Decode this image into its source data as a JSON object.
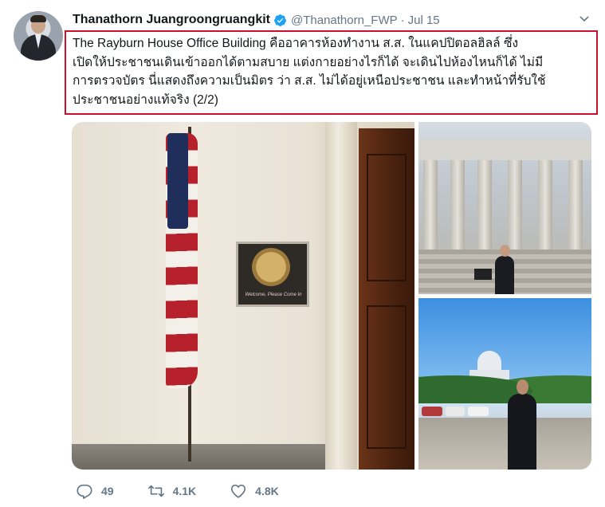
{
  "tweet": {
    "author_name": "Thanathorn Juangroongruangkit",
    "handle": "@Thanathorn_FWP",
    "separator": "·",
    "date": "Jul 15",
    "text_lines": [
      "The Rayburn House Office Building คืออาคารห้องทำงาน ส.ส. ในแคปปิตอลฮิลล์ ซึ่ง",
      "เปิดให้ประชาชนเดินเข้าออกได้ตามสบาย แต่งกายอย่างไรก็ได้ จะเดินไปห้องไหนก็ได้ ไม่มี",
      "การตรวจบัตร นี่แสดงถึงความเป็นมิตร ว่า ส.ส. ไม่ได้อยู่เหนือประชาชน และทำหน้าที่รับใช้",
      "ประชาชนอย่างแท้จริง (2/2)"
    ],
    "highlight_color": "#c8102e"
  },
  "media": {
    "plaque_text": "Welcome, Please Come In"
  },
  "actions": {
    "replies": "49",
    "retweets": "4.1K",
    "likes": "4.8K"
  },
  "icons": {
    "verified": "verified-badge-icon",
    "caret": "chevron-down-icon",
    "reply": "reply-icon",
    "retweet": "retweet-icon",
    "like": "heart-icon"
  },
  "colors": {
    "verified_blue": "#1da1f2",
    "muted": "#657786"
  }
}
